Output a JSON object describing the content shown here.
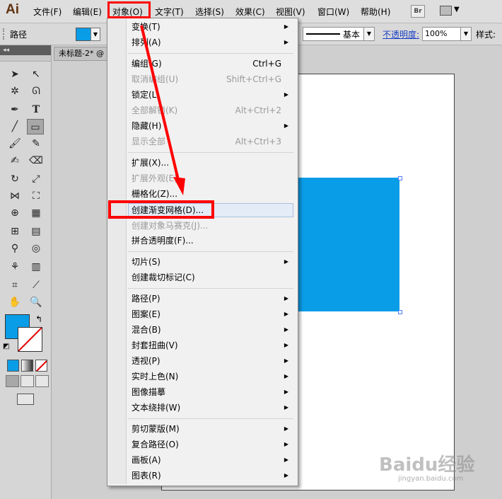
{
  "app": {
    "logo": "Ai"
  },
  "menubar": {
    "items": [
      "文件(F)",
      "编辑(E)",
      "对象(O)",
      "文字(T)",
      "选择(S)",
      "效果(C)",
      "视图(V)",
      "窗口(W)",
      "帮助(H)"
    ],
    "bridge_label": "Br"
  },
  "control_bar": {
    "selection_label": "路径",
    "fill_color": "#0a9de7",
    "stroke_profile": "基本",
    "opacity_label": "不透明度:",
    "opacity_value": "100%",
    "style_label": "样式:"
  },
  "document": {
    "tab_title": "未标题-2* @"
  },
  "colors": {
    "accent_blue": "#0a9de7",
    "annotation_red": "#ff0000"
  },
  "object_menu": {
    "items": [
      {
        "label": "变换(T)",
        "shortcut": "",
        "submenu": true,
        "disabled": false
      },
      {
        "label": "排列(A)",
        "shortcut": "",
        "submenu": true,
        "disabled": false
      },
      {
        "label": "编组(G)",
        "shortcut": "Ctrl+G",
        "submenu": false,
        "disabled": false
      },
      {
        "label": "取消编组(U)",
        "shortcut": "Shift+Ctrl+G",
        "submenu": false,
        "disabled": true
      },
      {
        "label": "锁定(L)",
        "shortcut": "",
        "submenu": true,
        "disabled": false
      },
      {
        "label": "全部解锁(K)",
        "shortcut": "Alt+Ctrl+2",
        "submenu": false,
        "disabled": true
      },
      {
        "label": "隐藏(H)",
        "shortcut": "",
        "submenu": true,
        "disabled": false
      },
      {
        "label": "显示全部",
        "shortcut": "Alt+Ctrl+3",
        "submenu": false,
        "disabled": true
      },
      {
        "label": "扩展(X)...",
        "shortcut": "",
        "submenu": false,
        "disabled": false
      },
      {
        "label": "扩展外观(E)",
        "shortcut": "",
        "submenu": false,
        "disabled": true
      },
      {
        "label": "栅格化(Z)...",
        "shortcut": "",
        "submenu": false,
        "disabled": false
      },
      {
        "label": "创建渐变网格(D)...",
        "shortcut": "",
        "submenu": false,
        "disabled": false
      },
      {
        "label": "创建对象马赛克(J)...",
        "shortcut": "",
        "submenu": false,
        "disabled": true
      },
      {
        "label": "拼合透明度(F)...",
        "shortcut": "",
        "submenu": false,
        "disabled": false
      },
      {
        "label": "切片(S)",
        "shortcut": "",
        "submenu": true,
        "disabled": false
      },
      {
        "label": "创建裁切标记(C)",
        "shortcut": "",
        "submenu": false,
        "disabled": false
      },
      {
        "label": "路径(P)",
        "shortcut": "",
        "submenu": true,
        "disabled": false
      },
      {
        "label": "图案(E)",
        "shortcut": "",
        "submenu": true,
        "disabled": false
      },
      {
        "label": "混合(B)",
        "shortcut": "",
        "submenu": true,
        "disabled": false
      },
      {
        "label": "封套扭曲(V)",
        "shortcut": "",
        "submenu": true,
        "disabled": false
      },
      {
        "label": "透视(P)",
        "shortcut": "",
        "submenu": true,
        "disabled": false
      },
      {
        "label": "实时上色(N)",
        "shortcut": "",
        "submenu": true,
        "disabled": false
      },
      {
        "label": "图像描摹",
        "shortcut": "",
        "submenu": true,
        "disabled": false
      },
      {
        "label": "文本绕排(W)",
        "shortcut": "",
        "submenu": true,
        "disabled": false
      },
      {
        "label": "剪切蒙版(M)",
        "shortcut": "",
        "submenu": true,
        "disabled": false
      },
      {
        "label": "复合路径(O)",
        "shortcut": "",
        "submenu": true,
        "disabled": false
      },
      {
        "label": "画板(A)",
        "shortcut": "",
        "submenu": true,
        "disabled": false
      },
      {
        "label": "图表(R)",
        "shortcut": "",
        "submenu": true,
        "disabled": false
      }
    ]
  },
  "watermark": {
    "brand": "Baidu经验",
    "url": "jingyan.baidu.com"
  }
}
